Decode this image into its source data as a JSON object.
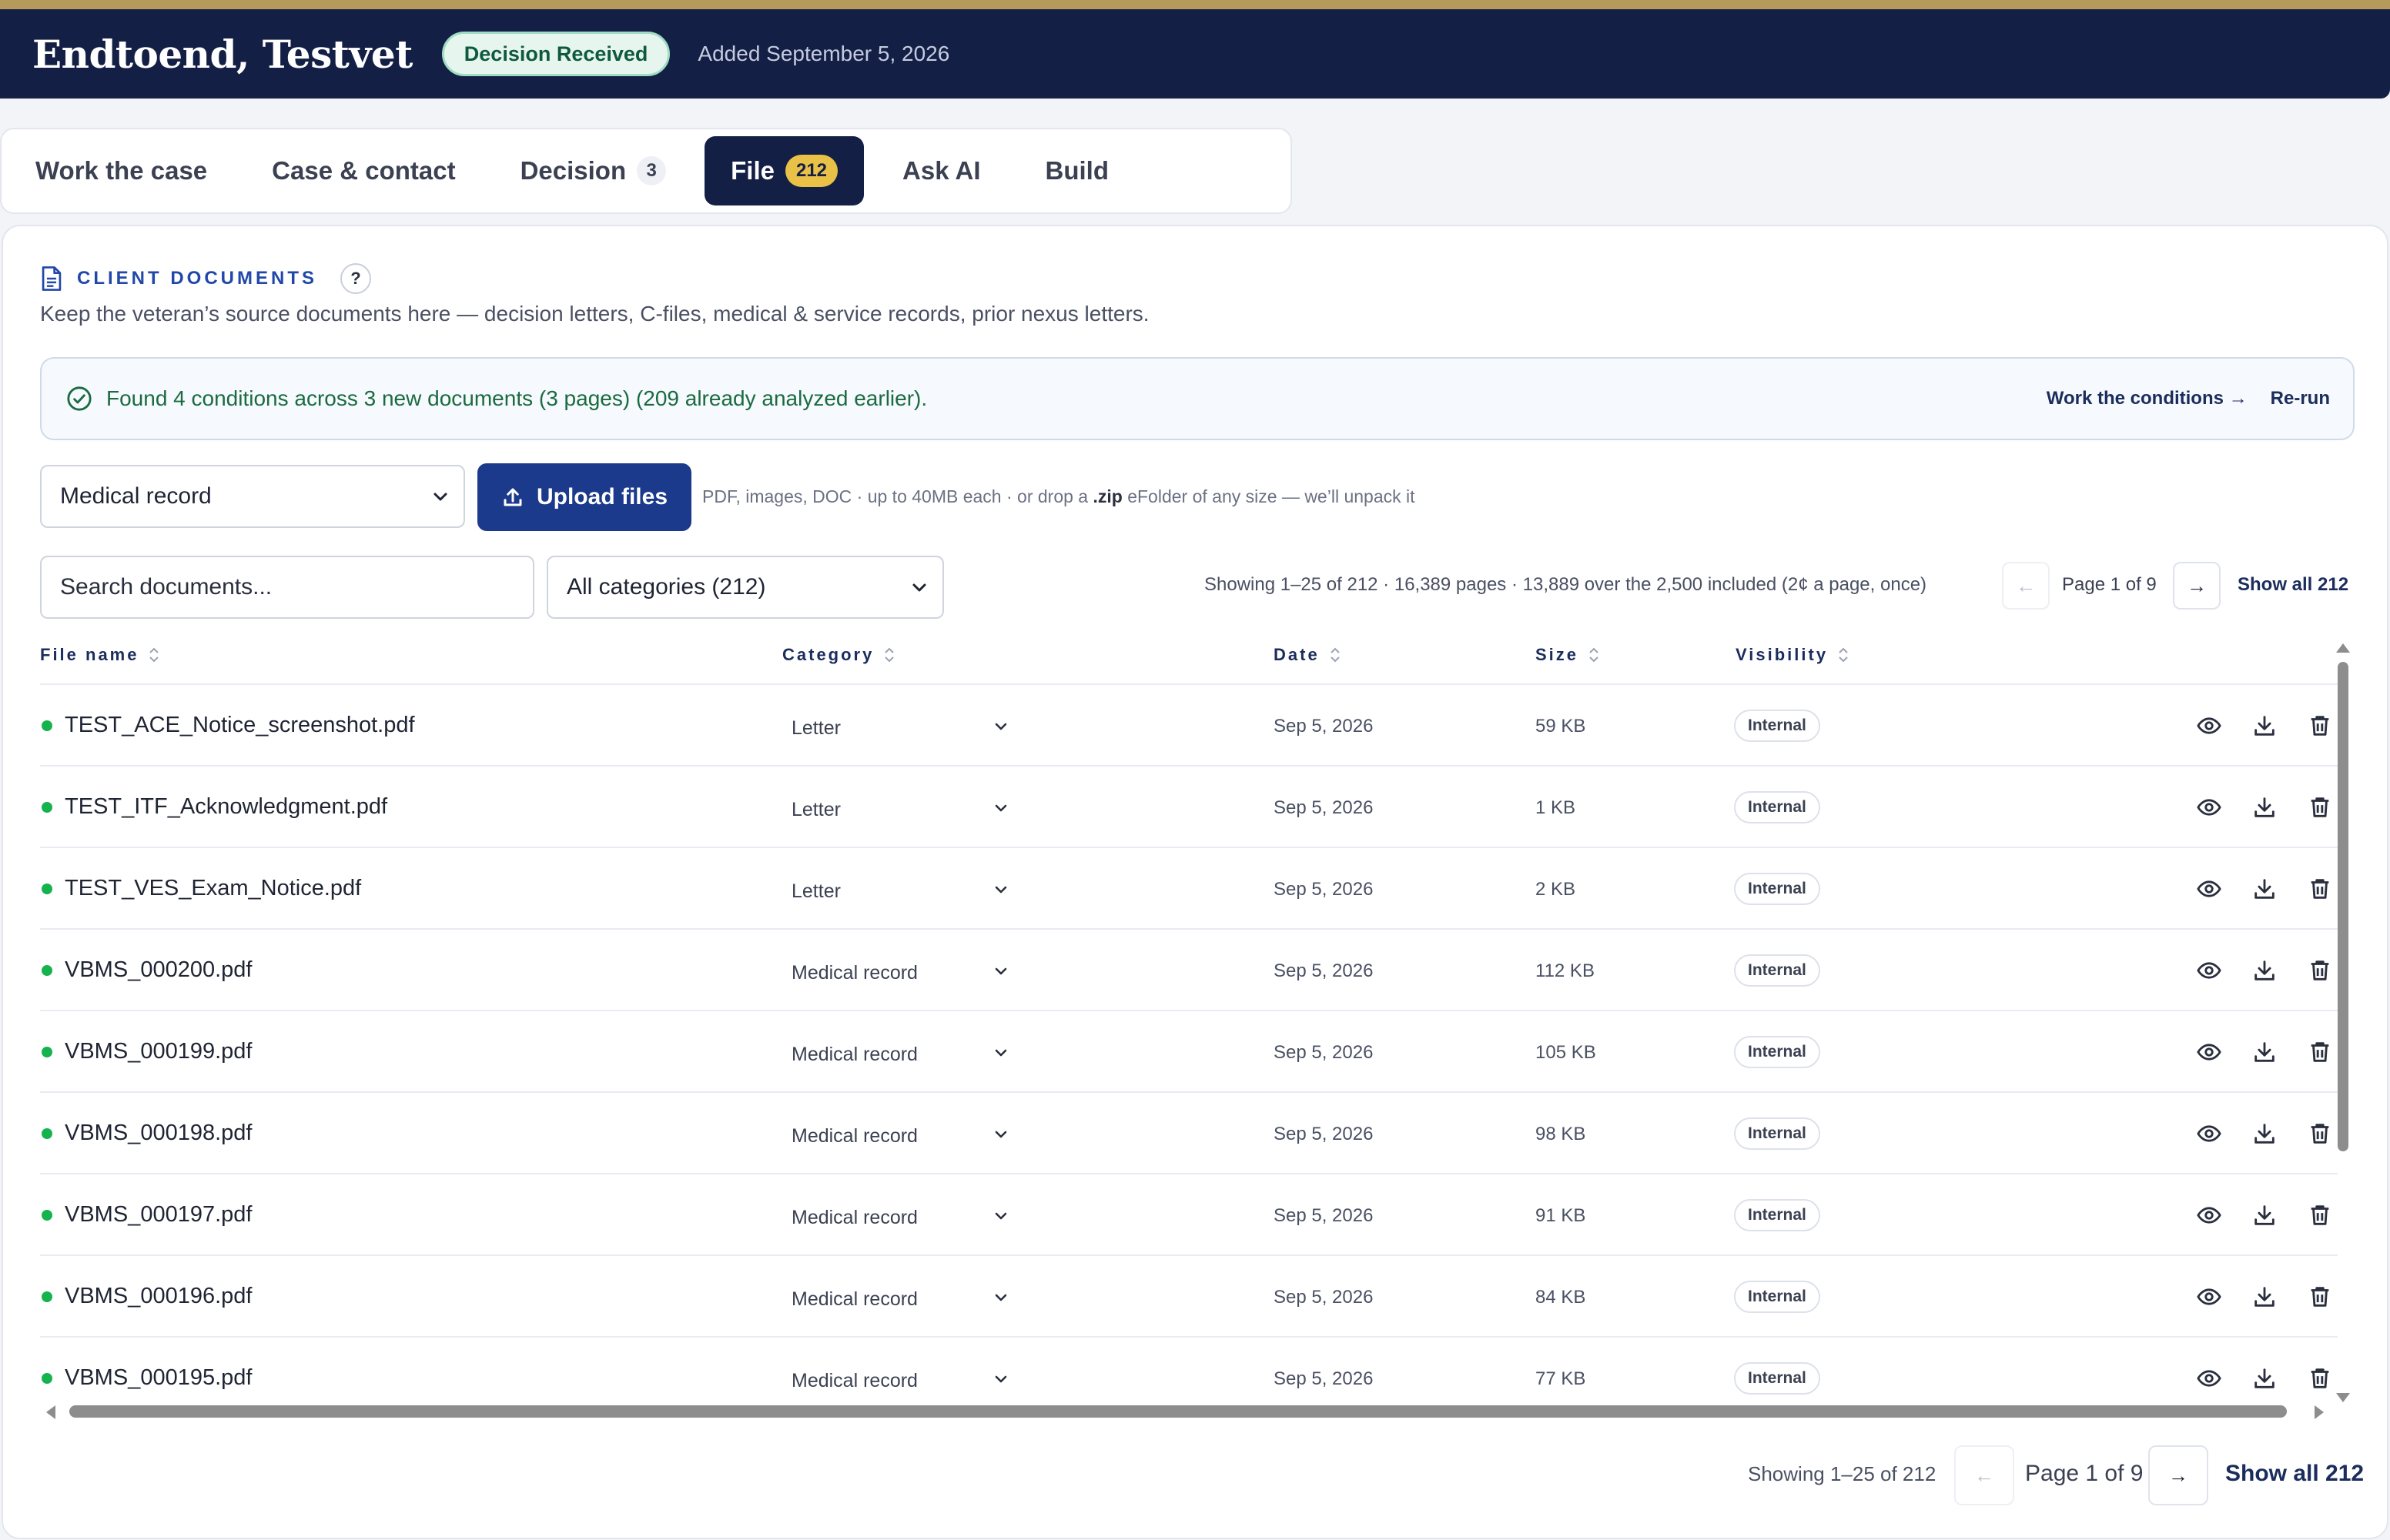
{
  "header": {
    "client_name": "Endtoend, Testvet",
    "status": "Decision Received",
    "added": "Added September 5, 2026"
  },
  "tabs": [
    {
      "label": "Work the case",
      "count": ""
    },
    {
      "label": "Case & contact",
      "count": ""
    },
    {
      "label": "Decision",
      "count": "3"
    },
    {
      "label": "File",
      "count": "212"
    },
    {
      "label": "Ask AI",
      "count": ""
    },
    {
      "label": "Build",
      "count": ""
    }
  ],
  "section": {
    "title": "CLIENT DOCUMENTS",
    "help": "?",
    "description": "Keep the veteran’s source documents here — decision letters, C-files, medical & service records, prior nexus letters."
  },
  "notice": {
    "text": "Found 4 conditions across 3 new documents (3 pages) (209 already analyzed earlier).",
    "work_link": "Work the conditions →",
    "rerun": "Re-run"
  },
  "upload": {
    "doc_type": "Medical record",
    "button": "Upload files",
    "hint_pre": "PDF, images, DOC · up to 40MB each · or drop a ",
    "hint_bold": ".zip",
    "hint_post": " eFolder of any size — we’ll unpack it"
  },
  "filters": {
    "search_placeholder": "Search documents...",
    "category": "All categories (212)"
  },
  "pager_top": {
    "summary": "Showing 1–25 of 212 · 16,389 pages · 13,889 over the 2,500 included (2¢ a page, once)",
    "prev": "←",
    "page": "Page 1 of 9",
    "next": "→",
    "show_all": "Show all 212"
  },
  "columns": [
    "File name",
    "Category",
    "Date",
    "Size",
    "Visibility"
  ],
  "rows": [
    {
      "name": "TEST_ACE_Notice_screenshot.pdf",
      "category": "Letter",
      "date": "Sep 5, 2026",
      "size": "59 KB",
      "visibility": "Internal"
    },
    {
      "name": "TEST_ITF_Acknowledgment.pdf",
      "category": "Letter",
      "date": "Sep 5, 2026",
      "size": "1 KB",
      "visibility": "Internal"
    },
    {
      "name": "TEST_VES_Exam_Notice.pdf",
      "category": "Letter",
      "date": "Sep 5, 2026",
      "size": "2 KB",
      "visibility": "Internal"
    },
    {
      "name": "VBMS_000200.pdf",
      "category": "Medical record",
      "date": "Sep 5, 2026",
      "size": "112 KB",
      "visibility": "Internal"
    },
    {
      "name": "VBMS_000199.pdf",
      "category": "Medical record",
      "date": "Sep 5, 2026",
      "size": "105 KB",
      "visibility": "Internal"
    },
    {
      "name": "VBMS_000198.pdf",
      "category": "Medical record",
      "date": "Sep 5, 2026",
      "size": "98 KB",
      "visibility": "Internal"
    },
    {
      "name": "VBMS_000197.pdf",
      "category": "Medical record",
      "date": "Sep 5, 2026",
      "size": "91 KB",
      "visibility": "Internal"
    },
    {
      "name": "VBMS_000196.pdf",
      "category": "Medical record",
      "date": "Sep 5, 2026",
      "size": "84 KB",
      "visibility": "Internal"
    },
    {
      "name": "VBMS_000195.pdf",
      "category": "Medical record",
      "date": "Sep 5, 2026",
      "size": "77 KB",
      "visibility": "Internal"
    }
  ],
  "pager_bottom": {
    "summary": "Showing 1–25 of 212",
    "prev": "←",
    "page": "Page 1 of 9",
    "next": "→",
    "show_all": "Show all 212"
  },
  "icons": {
    "row_actions": [
      "eye-icon",
      "download-icon",
      "trash-icon"
    ],
    "status_dot": "#15b34e",
    "brand": "#131f45",
    "accent": "#1c3a8c"
  }
}
